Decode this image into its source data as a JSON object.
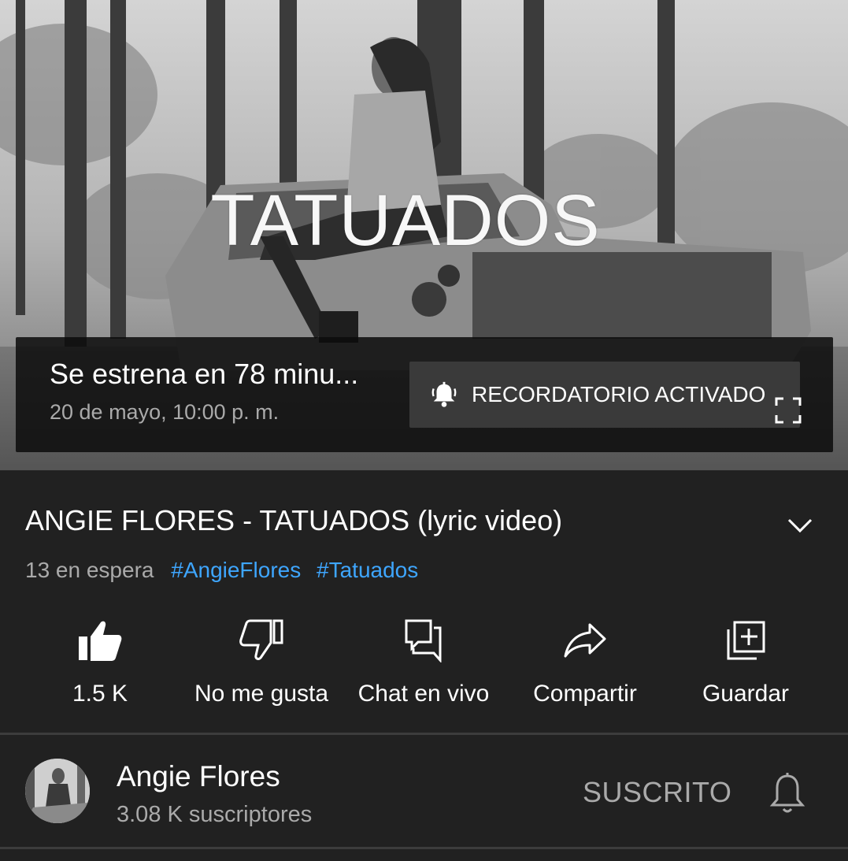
{
  "player": {
    "overlay_title": "TATUADOS",
    "premiere_text": "Se estrena en 78 minu...",
    "premiere_date": "20 de mayo, 10:00 p. m.",
    "reminder_label": "RECORDATORIO ACTIVADO",
    "icons": [
      "bell-ringing-icon",
      "fullscreen-icon"
    ]
  },
  "video": {
    "title": "ANGIE FLORES - TATUADOS (lyric video)",
    "waiting": "13 en espera",
    "hashtags": [
      "#AngieFlores",
      "#Tatuados"
    ],
    "hashtag_color": "#3ea6ff"
  },
  "actions": [
    {
      "label": "1.5 K",
      "icon": "thumbs-up-icon"
    },
    {
      "label": "No me gusta",
      "icon": "thumbs-down-icon"
    },
    {
      "label": "Chat en vivo",
      "icon": "chat-icon"
    },
    {
      "label": "Compartir",
      "icon": "share-icon"
    },
    {
      "label": "Guardar",
      "icon": "add-to-playlist-icon"
    }
  ],
  "channel": {
    "name": "Angie Flores",
    "subscribers": "3.08 K suscriptores",
    "subscribed_label": "SUSCRITO",
    "bell_icon": "notification-bell-icon"
  },
  "colors": {
    "background": "#212121",
    "secondary_text": "#aaaaaa",
    "link": "#3ea6ff"
  }
}
